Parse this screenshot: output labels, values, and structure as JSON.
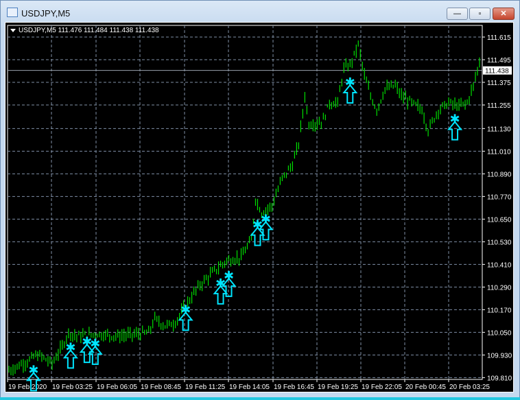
{
  "window": {
    "title": "USDJPY,M5",
    "minimize_label": "—",
    "maximize_label": "▫",
    "close_label": "✕"
  },
  "chart_data": {
    "type": "bar",
    "symbol_header": "USDJPY,M5  111.476 111.484 111.438 111.438",
    "current_price": "111.438",
    "price_ticks": [
      "111.615",
      "111.495",
      "111.375",
      "111.255",
      "111.130",
      "111.010",
      "110.890",
      "110.770",
      "110.650",
      "110.530",
      "110.410",
      "110.290",
      "110.170",
      "110.050",
      "109.930",
      "109.810"
    ],
    "time_ticks": [
      "19 Feb 2020",
      "19 Feb 03:25",
      "19 Feb 06:05",
      "19 Feb 08:45",
      "19 Feb 11:25",
      "19 Feb 14:05",
      "19 Feb 16:45",
      "19 Feb 19:25",
      "19 Feb 22:05",
      "20 Feb 00:45",
      "20 Feb 03:25"
    ],
    "ylim": [
      109.81,
      111.615
    ],
    "bar_count": 230,
    "series_anchors": [
      [
        0,
        109.848
      ],
      [
        10,
        109.902
      ],
      [
        13,
        109.928
      ],
      [
        16,
        109.921
      ],
      [
        21,
        109.884
      ],
      [
        26,
        109.975
      ],
      [
        29,
        110.048
      ],
      [
        33,
        110.03
      ],
      [
        43,
        110.041
      ],
      [
        53,
        110.03
      ],
      [
        63,
        110.041
      ],
      [
        68,
        110.048
      ],
      [
        71,
        110.121
      ],
      [
        76,
        110.084
      ],
      [
        81,
        110.102
      ],
      [
        86,
        110.193
      ],
      [
        93,
        110.302
      ],
      [
        100,
        110.375
      ],
      [
        106,
        110.43
      ],
      [
        113,
        110.448
      ],
      [
        118,
        110.539
      ],
      [
        120,
        110.757
      ],
      [
        123,
        110.684
      ],
      [
        128,
        110.721
      ],
      [
        133,
        110.866
      ],
      [
        138,
        110.939
      ],
      [
        141,
        111.048
      ],
      [
        144,
        111.302
      ],
      [
        146,
        111.157
      ],
      [
        150,
        111.157
      ],
      [
        153,
        111.175
      ],
      [
        156,
        111.266
      ],
      [
        160,
        111.266
      ],
      [
        163,
        111.448
      ],
      [
        166,
        111.466
      ],
      [
        170,
        111.575
      ],
      [
        173,
        111.411
      ],
      [
        176,
        111.302
      ],
      [
        179,
        111.23
      ],
      [
        183,
        111.339
      ],
      [
        188,
        111.357
      ],
      [
        191,
        111.302
      ],
      [
        196,
        111.266
      ],
      [
        201,
        111.23
      ],
      [
        204,
        111.121
      ],
      [
        209,
        111.23
      ],
      [
        214,
        111.266
      ],
      [
        219,
        111.248
      ],
      [
        223,
        111.266
      ],
      [
        226,
        111.357
      ],
      [
        229,
        111.484
      ]
    ],
    "signals": [
      [
        12,
        109.85
      ],
      [
        30,
        109.97
      ],
      [
        38,
        110.0
      ],
      [
        42,
        109.99
      ],
      [
        86,
        110.17
      ],
      [
        103,
        110.31
      ],
      [
        107,
        110.35
      ],
      [
        121,
        110.62
      ],
      [
        125,
        110.65
      ],
      [
        166,
        111.375
      ],
      [
        217,
        111.18
      ]
    ],
    "colors": {
      "bars": "#00e000",
      "signal": "#00e5ff",
      "grid": "#7f8fa6",
      "current": "#9aa3ad"
    }
  }
}
